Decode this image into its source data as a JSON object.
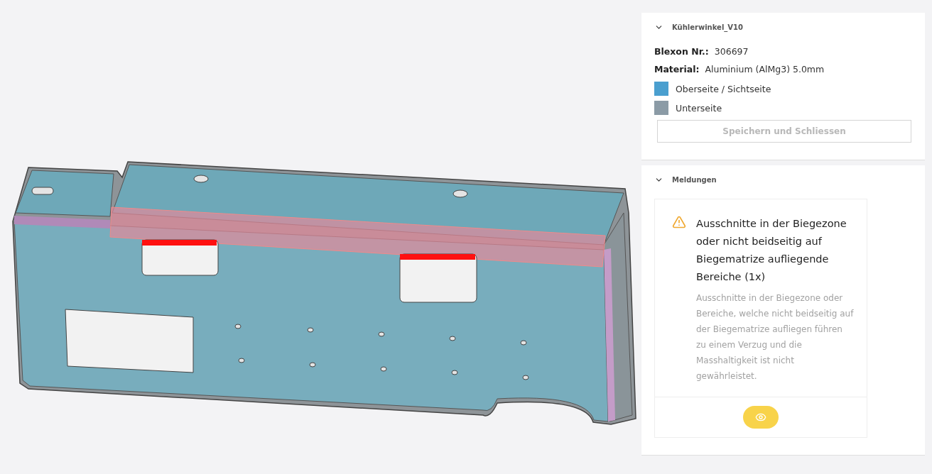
{
  "part_panel": {
    "title": "Kühlerwinkel_V10",
    "expanded": true,
    "fields": [
      {
        "label": "Blexon Nr.:",
        "value": "306697"
      },
      {
        "label": "Material:",
        "value": "Aluminium (AlMg3) 5.0mm"
      }
    ],
    "legend": [
      {
        "label": "Oberseite / Sichtseite",
        "color": "#4a9fcf"
      },
      {
        "label": "Unterseite",
        "color": "#8b9ba6"
      }
    ],
    "save_button": {
      "label": "Speichern und Schliessen",
      "disabled": true
    }
  },
  "messages_panel": {
    "title": "Meldungen",
    "expanded": true,
    "messages": [
      {
        "title": "Ausschnitte in der Biegezone oder nicht beidseitig auf Biegematrize aufliegende Bereiche (1x)",
        "description": "Ausschnitte in der Biegezone oder Bereiche, welche nicht beidseitig auf der Biegematrize aufliegen führen zu einem Verzug und die Masshaltigkeit ist nicht gewährleistet."
      }
    ]
  }
}
